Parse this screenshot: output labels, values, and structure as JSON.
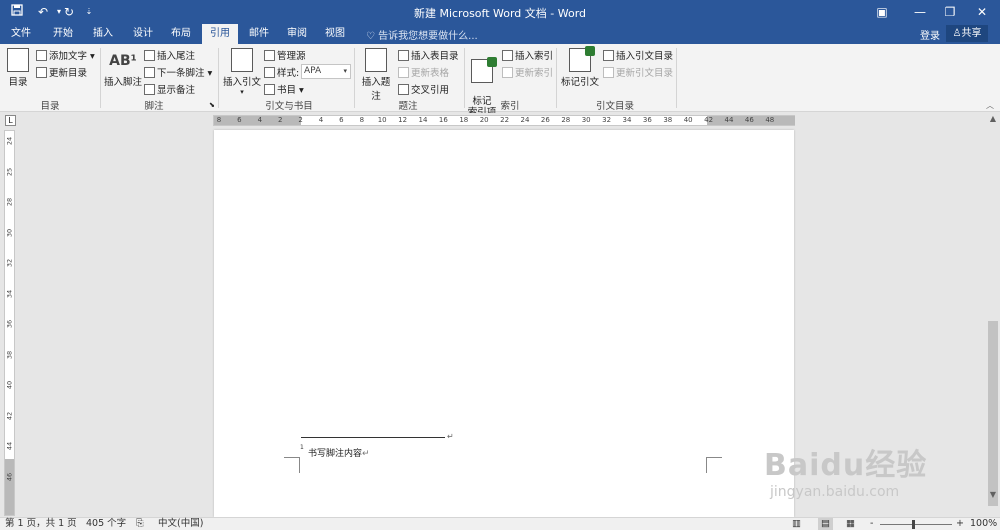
{
  "titlebar": {
    "title": "新建 Microsoft Word 文档 - Word",
    "icons": [
      "save-icon",
      "undo-icon",
      "redo-icon",
      "customize-icon"
    ],
    "window_controls": [
      "ribbon-display-icon",
      "minimize-icon",
      "restore-icon",
      "close-icon"
    ]
  },
  "tabs": {
    "items": [
      "文件",
      "开始",
      "插入",
      "设计",
      "布局",
      "引用",
      "邮件",
      "审阅",
      "视图"
    ],
    "active": "引用",
    "tell_me": "告诉我您想要做什么...",
    "login": "登录",
    "share": "共享"
  },
  "ribbon": {
    "toc": {
      "big": "目录",
      "add_text": "添加文字",
      "update": "更新目录",
      "group": "目录"
    },
    "footnotes": {
      "big": "插入脚注",
      "insert_endnote": "插入尾注",
      "next_footnote": "下一条脚注",
      "show_notes": "显示备注",
      "group": "脚注"
    },
    "citations": {
      "big": "插入引文",
      "manage_sources": "管理源",
      "style_label": "样式:",
      "style_value": "APA",
      "bibliography": "书目",
      "group": "引文与书目"
    },
    "captions": {
      "big": "插入题注",
      "insert_table_of_figures": "插入表目录",
      "update_table": "更新表格",
      "cross_reference": "交叉引用",
      "group": "题注"
    },
    "index": {
      "big": "标记\n索引项",
      "insert_index": "插入索引",
      "update_index": "更新索引",
      "group": "索引"
    },
    "authorities": {
      "big": "标记引文",
      "insert_table": "插入引文目录",
      "update_table": "更新引文目录",
      "group": "引文目录"
    }
  },
  "ruler": {
    "h_numbers": [
      "8",
      "6",
      "4",
      "2",
      "2",
      "4",
      "6",
      "8",
      "10",
      "12",
      "14",
      "16",
      "18",
      "20",
      "22",
      "24",
      "26",
      "28",
      "30",
      "32",
      "34",
      "36",
      "38",
      "40",
      "42",
      "44",
      "46",
      "48"
    ],
    "v_numbers": [
      "24",
      "25",
      "28",
      "30",
      "32",
      "34",
      "36",
      "38",
      "40",
      "42",
      "44",
      "46"
    ]
  },
  "document": {
    "footnote_number": "1",
    "footnote_text": "书写脚注内容",
    "paragraph_mark": "↵"
  },
  "watermark": {
    "line1": "Baidu经验",
    "line2": "jingyan.baidu.com"
  },
  "status": {
    "page": "第 1 页，共 1 页",
    "words": "405 个字",
    "language": "中文(中国)",
    "zoom": "100%",
    "zoom_minus": "-",
    "zoom_plus": "+"
  }
}
